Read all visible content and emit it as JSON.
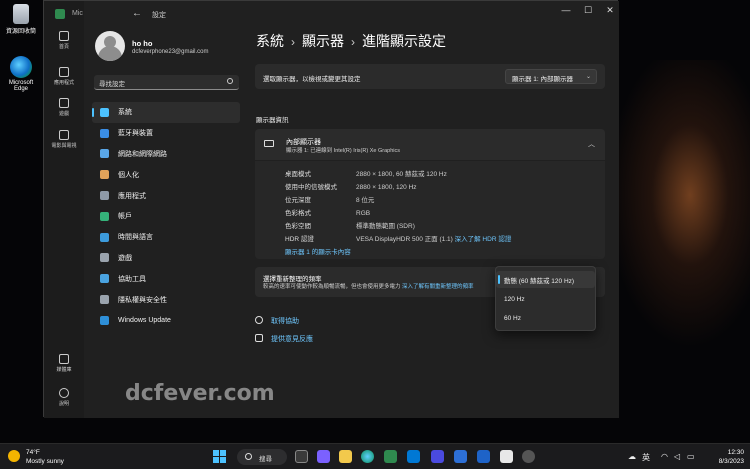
{
  "desktop": {
    "recycle_label": "資源回收筒",
    "edge_label": "Microsoft Edge"
  },
  "window": {
    "tab_label": "Mic",
    "title": "設定"
  },
  "rail": {
    "items": [
      "首頁",
      "應用程式",
      "遊戲",
      "電影與電視",
      "媒體庫",
      "說明"
    ]
  },
  "profile": {
    "name": "ho ho",
    "email": "dcfeverphone23@gmail.com"
  },
  "search": {
    "placeholder": "尋找設定"
  },
  "nav": {
    "items": [
      {
        "label": "系統",
        "color": "#4cc2ff"
      },
      {
        "label": "藍牙與裝置",
        "color": "#3a8ee6"
      },
      {
        "label": "網路和網際網路",
        "color": "#5aa7e8"
      },
      {
        "label": "個人化",
        "color": "#e0a25a"
      },
      {
        "label": "應用程式",
        "color": "#8e9aa8"
      },
      {
        "label": "帳戶",
        "color": "#35b37a"
      },
      {
        "label": "時間與語言",
        "color": "#3c9bdc"
      },
      {
        "label": "遊戲",
        "color": "#9aa3ad"
      },
      {
        "label": "協助工具",
        "color": "#4aa3e0"
      },
      {
        "label": "隱私權與安全性",
        "color": "#9aa3ad"
      },
      {
        "label": "Windows Update",
        "color": "#2e8fd8"
      }
    ]
  },
  "breadcrumb": {
    "part1": "系統",
    "part2": "顯示器",
    "part3": "進階顯示設定",
    "separator": "›"
  },
  "display_select": {
    "label": "選取顯示器，以檢視或變更其設定",
    "value": "顯示器 1: 內部顯示器"
  },
  "info": {
    "section_label": "顯示器資訊",
    "title": "內部顯示器",
    "subtitle": "顯示器 1: 已連線到 Intel(R) Iris(R) Xe Graphics",
    "rows": [
      {
        "key": "桌面模式",
        "value": "2880 × 1800, 60 赫茲或 120 Hz"
      },
      {
        "key": "使用中的信號模式",
        "value": "2880 × 1800, 120 Hz"
      },
      {
        "key": "位元深度",
        "value": "8 位元"
      },
      {
        "key": "色彩格式",
        "value": "RGB"
      },
      {
        "key": "色彩空間",
        "value": "標準動態範圍 (SDR)"
      },
      {
        "key": "HDR 認證",
        "value": "VESA DisplayHDR 500 正面 (1.1)",
        "link": "深入了解 HDR 認證"
      }
    ],
    "adapter_link": "顯示器 1 的顯示卡內容"
  },
  "refresh": {
    "title": "選擇重新整理的頻率",
    "description": "較高的速率可使動作較為順暢流暢，但也會使用更多電力",
    "link": "深入了解有關重新整理的頻率"
  },
  "popup": {
    "options": [
      "動態 (60 赫茲或 120 Hz)",
      "120 Hz",
      "60 Hz"
    ]
  },
  "help": {
    "get_help": "取得協助",
    "feedback": "提供意見反應"
  },
  "watermark": "dcfever.com",
  "taskbar": {
    "temp": "74°F",
    "weather": "Mostly sunny",
    "search_label": "搜尋",
    "ime": "英",
    "time": "12:30",
    "date": "8/3/2023"
  }
}
